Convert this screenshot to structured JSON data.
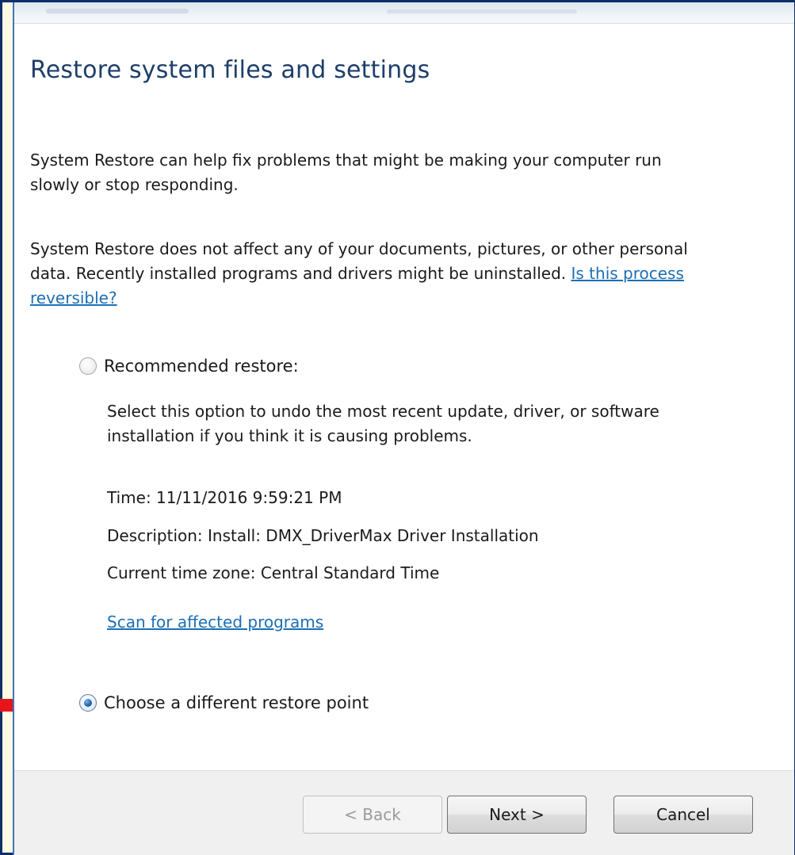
{
  "dialog": {
    "heading": "Restore system files and settings",
    "intro": "System Restore can help fix problems that might be making your computer run slowly or stop responding.",
    "note_text": "System Restore does not affect any of your documents, pictures, or other personal data. Recently installed programs and drivers might be uninstalled.",
    "reversible_link": "Is this process reversible?"
  },
  "options": {
    "recommended": {
      "label": "Recommended restore:",
      "selected": false,
      "description": "Select this option to undo the most recent update, driver, or software installation if you think it is causing problems.",
      "time": "Time: 11/11/2016 9:59:21 PM",
      "restore_description": "Description: Install: DMX_DriverMax Driver Installation",
      "time_zone": "Current time zone: Central Standard Time",
      "scan_link": "Scan for affected programs"
    },
    "different": {
      "label": "Choose a different restore point",
      "selected": true
    }
  },
  "buttons": {
    "back": "< Back",
    "next": "Next >",
    "cancel": "Cancel"
  },
  "colors": {
    "heading": "#1e3e6a",
    "link": "#1c6fb5",
    "arrow": "#e8141b",
    "page_background": "#fdfbe4",
    "frame_border": "#0f2f6a"
  },
  "icons": {
    "annotation_arrow": "red-arrow-right"
  }
}
